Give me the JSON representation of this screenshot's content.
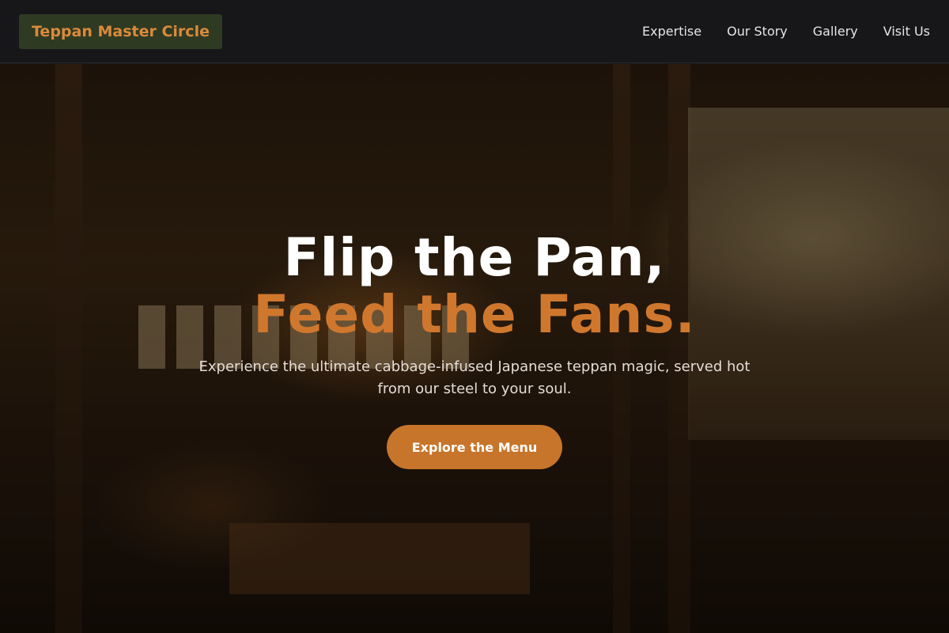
{
  "nav": {
    "brand": "Teppan Master Circle",
    "links": [
      "Expertise",
      "Our Story",
      "Gallery",
      "Visit Us"
    ]
  },
  "hero": {
    "headline_line1": "Flip the Pan,",
    "headline_line2": "Feed the Fans.",
    "subtitle": "Experience the ultimate cabbage-infused Japanese teppan magic, served hot from our steel to your soul.",
    "cta_label": "Explore the Menu"
  },
  "colors": {
    "accent": "#c7752b",
    "brand_bg": "#2f3a22",
    "nav_bg": "#17171a"
  }
}
